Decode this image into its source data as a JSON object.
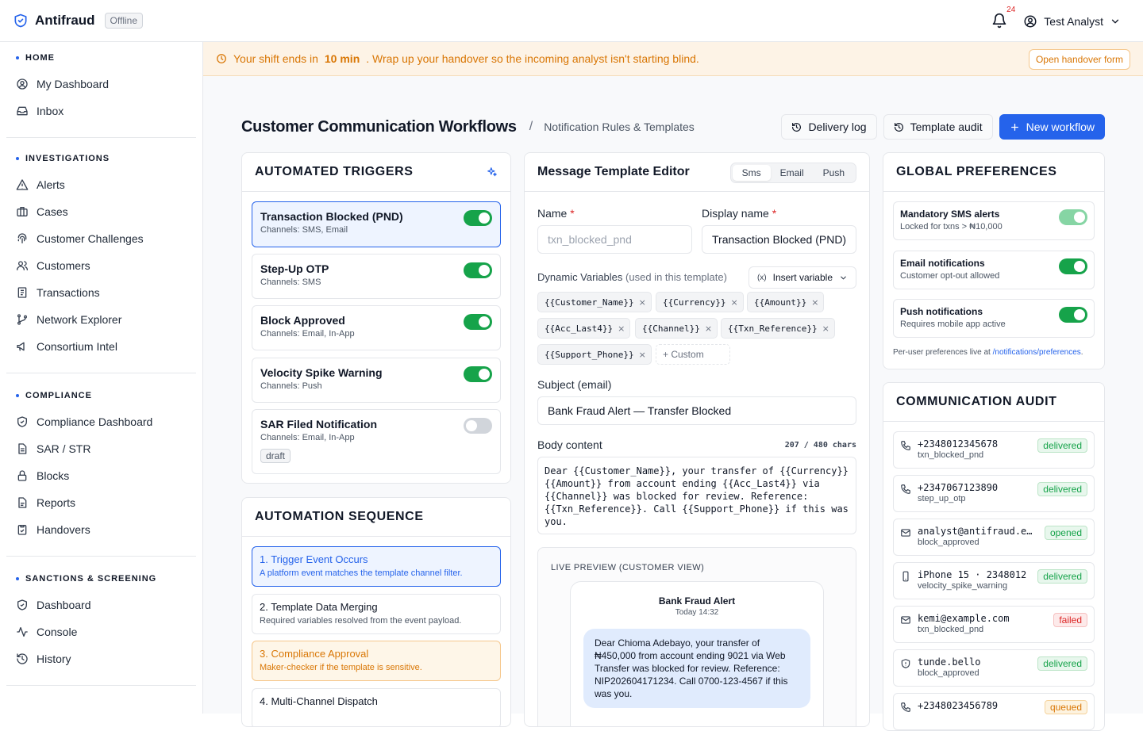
{
  "app": {
    "name": "Antifraud",
    "status": "Offline",
    "notifications": "24",
    "user": "Test Analyst"
  },
  "colors": {
    "accent": "#2563eb",
    "success": "#16a34a",
    "warning": "#d97706",
    "danger": "#dc2626"
  },
  "nav": {
    "home": {
      "heading": "HOME",
      "items": [
        "My Dashboard",
        "Inbox"
      ]
    },
    "investigations": {
      "heading": "INVESTIGATIONS",
      "items": [
        "Alerts",
        "Cases",
        "Customer Challenges",
        "Customers",
        "Transactions",
        "Network Explorer",
        "Consortium Intel"
      ]
    },
    "compliance": {
      "heading": "COMPLIANCE",
      "items": [
        "Compliance Dashboard",
        "SAR / STR",
        "Blocks",
        "Reports",
        "Handovers"
      ]
    },
    "sanctions": {
      "heading": "SANCTIONS & SCREENING",
      "items": [
        "Dashboard",
        "Console",
        "History"
      ]
    }
  },
  "banner": {
    "prefix": "Your shift ends in",
    "minutes": "10 min",
    "suffix": ". Wrap up your handover so the incoming analyst isn't starting blind.",
    "button": "Open handover form"
  },
  "header": {
    "title": "Customer Communication Workflows",
    "separator": "/",
    "subtitle": "Notification Rules & Templates",
    "delivery_log": "Delivery log",
    "template_audit": "Template audit",
    "new_workflow": "New workflow"
  },
  "triggers": {
    "title": "AUTOMATED TRIGGERS",
    "items": [
      {
        "name": "Transaction Blocked (PND)",
        "channels": "Channels: SMS, Email",
        "enabled": true
      },
      {
        "name": "Step-Up OTP",
        "channels": "Channels: SMS",
        "enabled": true
      },
      {
        "name": "Block Approved",
        "channels": "Channels: Email, In-App",
        "enabled": true
      },
      {
        "name": "Velocity Spike Warning",
        "channels": "Channels: Push",
        "enabled": true
      },
      {
        "name": "SAR Filed Notification",
        "channels": "Channels: Email, In-App",
        "enabled": false,
        "badge": "draft"
      }
    ]
  },
  "sequence": {
    "title": "AUTOMATION SEQUENCE",
    "steps": [
      {
        "title": "1. Trigger Event Occurs",
        "desc": "A platform event matches the template channel filter."
      },
      {
        "title": "2. Template Data Merging",
        "desc": "Required variables resolved from the event payload."
      },
      {
        "title": "3. Compliance Approval",
        "desc": "Maker-checker if the template is sensitive."
      },
      {
        "title": "4. Multi-Channel Dispatch",
        "desc": ""
      }
    ]
  },
  "editor": {
    "title": "Message Template Editor",
    "tabs": [
      "Sms",
      "Email",
      "Push"
    ],
    "name_label": "Name",
    "name_placeholder": "txn_blocked_pnd",
    "display_label": "Display name",
    "display_value": "Transaction Blocked (PND)",
    "vars_label": "Dynamic Variables",
    "vars_hint": "(used in this template)",
    "insert_button": "Insert variable",
    "variables": [
      "{{Customer_Name}}",
      "{{Currency}}",
      "{{Amount}}",
      "{{Acc_Last4}}",
      "{{Channel}}",
      "{{Txn_Reference}}",
      "{{Support_Phone}}"
    ],
    "custom_chip": "+ Custom",
    "subject_label": "Subject (email)",
    "subject_value": "Bank Fraud Alert — Transfer Blocked",
    "body_label": "Body content",
    "body_count": "207 / 480 chars",
    "body_value": "Dear {{Customer_Name}}, your transfer of {{Currency}}{{Amount}} from account ending {{Acc_Last4}} via {{Channel}} was blocked for review. Reference: {{Txn_Reference}}. Call {{Support_Phone}} if this was you.",
    "preview_label": "LIVE PREVIEW (CUSTOMER VIEW)",
    "preview_sender": "Bank Fraud Alert",
    "preview_time": "Today 14:32",
    "preview_message": "Dear Chioma Adebayo, your transfer of ₦450,000 from account ending 9021 via Web Transfer was blocked for review. Reference: NIP202604171234. Call 0700-123-4567 if this was you."
  },
  "prefs": {
    "title": "GLOBAL PREFERENCES",
    "items": [
      {
        "title": "Mandatory SMS alerts",
        "sub": "Locked for txns > ₦10,000",
        "state": "locked"
      },
      {
        "title": "Email notifications",
        "sub": "Customer opt-out allowed",
        "state": "on"
      },
      {
        "title": "Push notifications",
        "sub": "Requires mobile app active",
        "state": "on"
      }
    ],
    "footer_prefix": "Per-user preferences live at",
    "footer_link": "/notifications/preferences",
    "footer_suffix": "."
  },
  "audit": {
    "title": "COMMUNICATION AUDIT",
    "items": [
      {
        "icon": "phone-icon",
        "target": "+2348012345678",
        "template": "txn_blocked_pnd",
        "status": "delivered"
      },
      {
        "icon": "phone-icon",
        "target": "+2347067123890",
        "template": "step_up_otp",
        "status": "delivered"
      },
      {
        "icon": "mail-icon",
        "target": "analyst@antifraud.example",
        "template": "block_approved",
        "status": "opened"
      },
      {
        "icon": "smartphone-icon",
        "target": "iPhone 15 · 2348012",
        "template": "velocity_spike_warning",
        "status": "delivered"
      },
      {
        "icon": "mail-icon",
        "target": "kemi@example.com",
        "template": "txn_blocked_pnd",
        "status": "failed"
      },
      {
        "icon": "shield-icon",
        "target": "tunde.bello",
        "template": "block_approved",
        "status": "delivered"
      },
      {
        "icon": "phone-icon",
        "target": "+2348023456789",
        "template": "",
        "status": "queued"
      }
    ]
  }
}
